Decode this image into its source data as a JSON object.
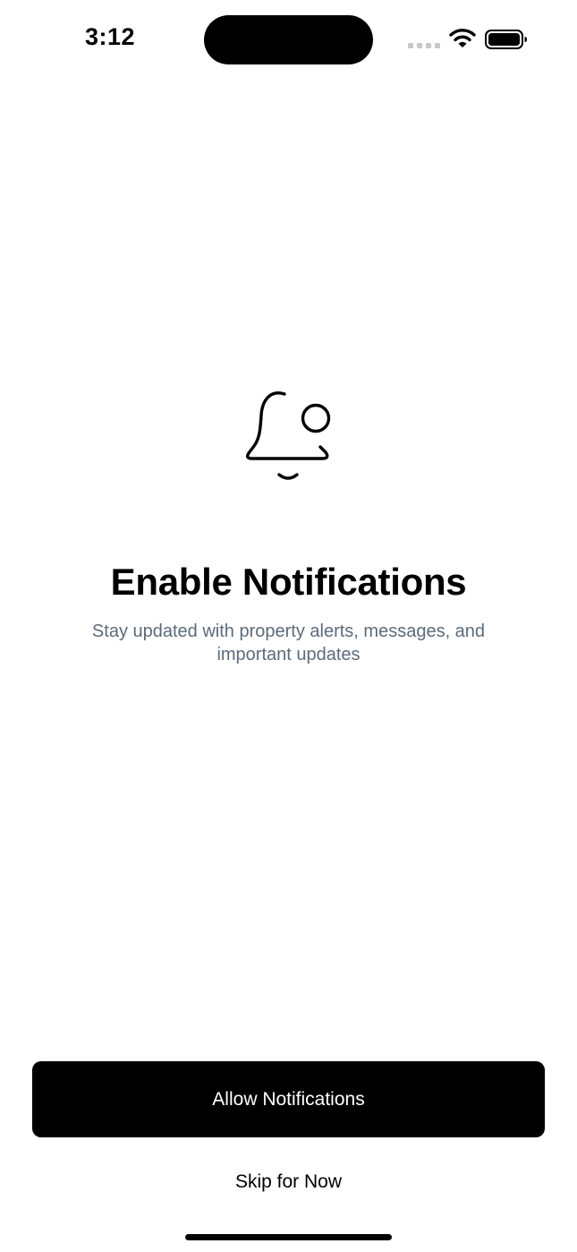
{
  "status_bar": {
    "time": "3:12",
    "icons": [
      "signal-dots-icon",
      "wifi-icon",
      "battery-icon"
    ]
  },
  "content": {
    "icon": "bell-icon",
    "title": "Enable Notifications",
    "subtitle": "Stay updated with property alerts, messages, and important updates"
  },
  "actions": {
    "allow_label": "Allow Notifications",
    "skip_label": "Skip for Now"
  },
  "colors": {
    "primary_button": "#000000",
    "primary_button_text": "#ffffff",
    "subtitle_text": "#5b6b7b",
    "signal_dots": "#c7c7cc"
  }
}
